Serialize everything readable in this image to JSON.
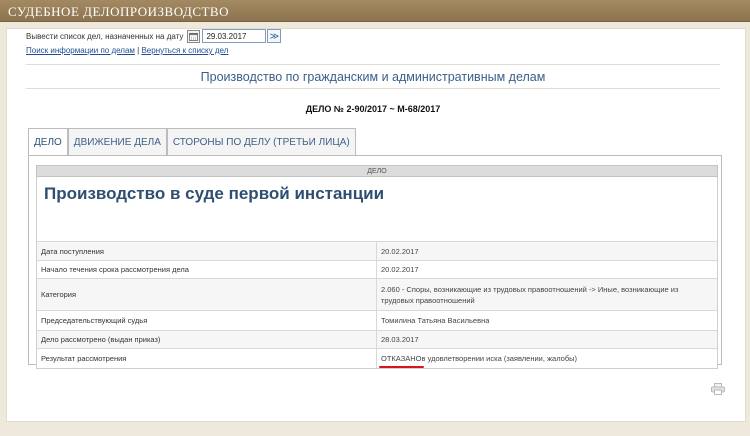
{
  "header": {
    "title": "СУДЕБНОЕ ДЕЛОПРОИЗВОДСТВО"
  },
  "date_filter": {
    "label": "Вывести список дел, назначенных на дату",
    "date_value": "29.03.2017",
    "go_symbol": "≫"
  },
  "links": {
    "search": "Поиск информации по делам",
    "separator": "|",
    "back": "Вернуться к списку дел"
  },
  "section_title": "Производство по гражданским и административным делам",
  "case_number": "ДЕЛО № 2-90/2017 ~ М-68/2017",
  "tabs": [
    {
      "label": "ДЕЛО",
      "active": true
    },
    {
      "label": "ДВИЖЕНИЕ ДЕЛА",
      "active": false
    },
    {
      "label": "СТОРОНЫ ПО ДЕЛУ (ТРЕТЬИ ЛИЦА)",
      "active": false
    }
  ],
  "table": {
    "header": "ДЕЛО",
    "title": "Производство в суде первой инстанции",
    "rows": [
      {
        "key": "Дата поступления",
        "value": "20.02.2017"
      },
      {
        "key": "Начало течения срока рассмотрения дела",
        "value": "20.02.2017"
      },
      {
        "key": "Категория",
        "value": "2.060 - Споры, возникающие из трудовых правоотношений -> Иные, возникающие из трудовых правоотношений"
      },
      {
        "key": "Председательствующий судья",
        "value": "Томилина Татьяна Васильевна"
      },
      {
        "key": "Дело рассмотрено (выдан приказ)",
        "value": "28.03.2017"
      },
      {
        "key": "Результат рассмотрения",
        "value_highlight": "ОТКАЗАНО",
        "value_rest": " в удовлетворении иска (заявлении, жалобы)"
      }
    ]
  },
  "colors": {
    "highlight_underline": "#d4151b",
    "header_bar": "#8d7450",
    "link": "#1f4f93"
  },
  "icons": {
    "calendar": "calendar-icon",
    "print": "printer-icon"
  }
}
